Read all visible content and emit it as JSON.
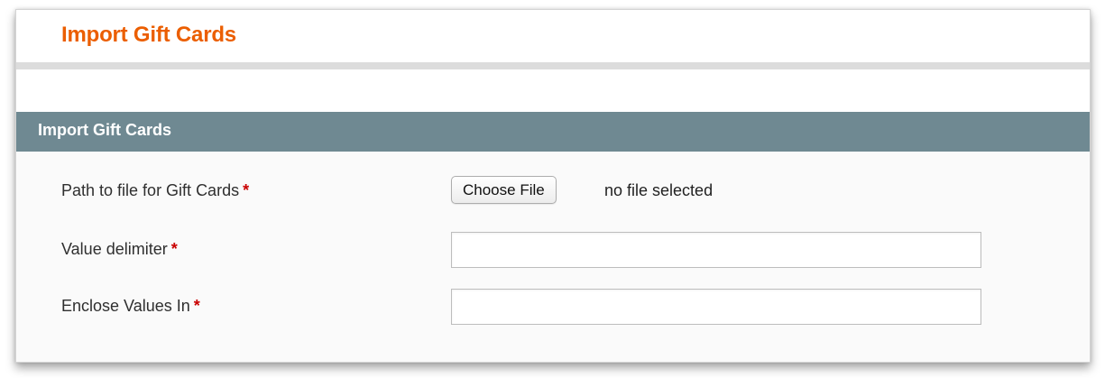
{
  "page": {
    "title": "Import Gift Cards"
  },
  "section": {
    "title": "Import Gift Cards"
  },
  "form": {
    "required_marker": "*",
    "file_field": {
      "label": "Path to file for Gift Cards",
      "button_label": "Choose File",
      "status": "no file selected"
    },
    "delimiter_field": {
      "label": "Value delimiter",
      "value": ""
    },
    "enclosure_field": {
      "label": "Enclose Values In",
      "value": ""
    }
  },
  "colors": {
    "page_title": "#eb5e00",
    "section_header_bg": "#6f8992",
    "required_marker": "#c90000"
  }
}
